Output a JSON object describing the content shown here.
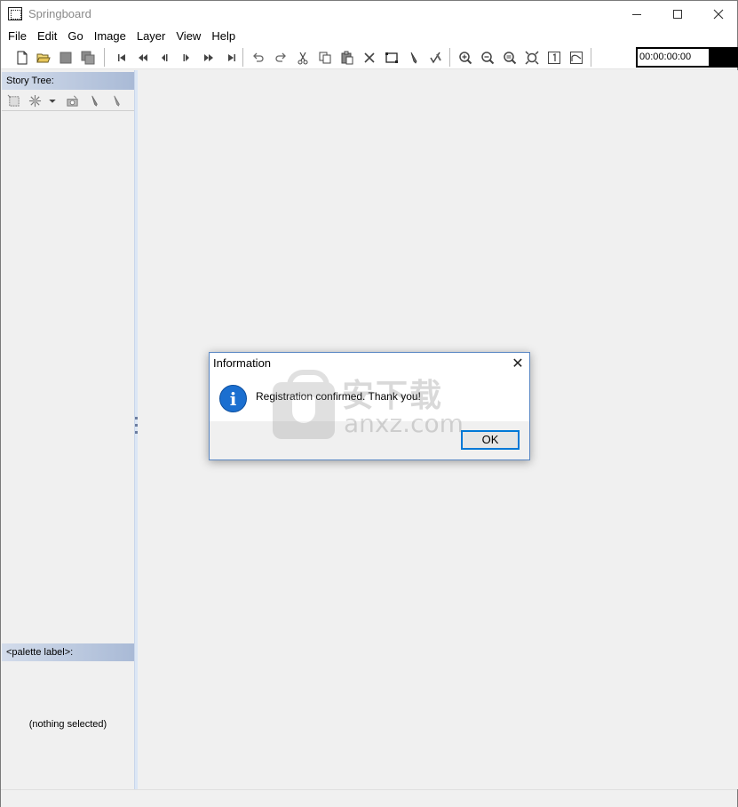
{
  "window": {
    "title": "Springboard"
  },
  "menu": {
    "items": [
      {
        "label": "File"
      },
      {
        "label": "Edit"
      },
      {
        "label": "Go"
      },
      {
        "label": "Image"
      },
      {
        "label": "Layer"
      },
      {
        "label": "View"
      },
      {
        "label": "Help"
      }
    ]
  },
  "toolbar": {
    "timecode": "00:00:00:00",
    "icons": [
      "new-file-icon",
      "open-folder-icon",
      "save-icon",
      "save-all-icon",
      "first-frame-icon",
      "rewind-icon",
      "step-back-icon",
      "step-forward-icon",
      "fast-forward-icon",
      "last-frame-icon",
      "undo-icon",
      "redo-icon",
      "cut-icon",
      "copy-icon",
      "paste-icon",
      "delete-icon",
      "frame-icon",
      "pencil-icon",
      "check-pencil-icon",
      "zoom-in-icon",
      "zoom-out-icon",
      "zoom-fit-icon",
      "zoom-full-icon",
      "actual-size-icon",
      "image-icon"
    ]
  },
  "story_tree": {
    "header": "Story Tree:",
    "tools": [
      "add-frame-icon",
      "burst-icon",
      "dropdown-arrow-icon",
      "camera-icon",
      "pen-icon",
      "brush-icon"
    ]
  },
  "palette": {
    "header": "<palette label>:",
    "empty_text": "(nothing selected)"
  },
  "dialog": {
    "title": "Information",
    "message": "Registration confirmed.  Thank you!",
    "ok_label": "OK",
    "close_glyph": "✕",
    "icon": "info-icon",
    "info_glyph": "i"
  },
  "watermark": {
    "cn_text": "安下载",
    "en_text": "anxz.com"
  }
}
